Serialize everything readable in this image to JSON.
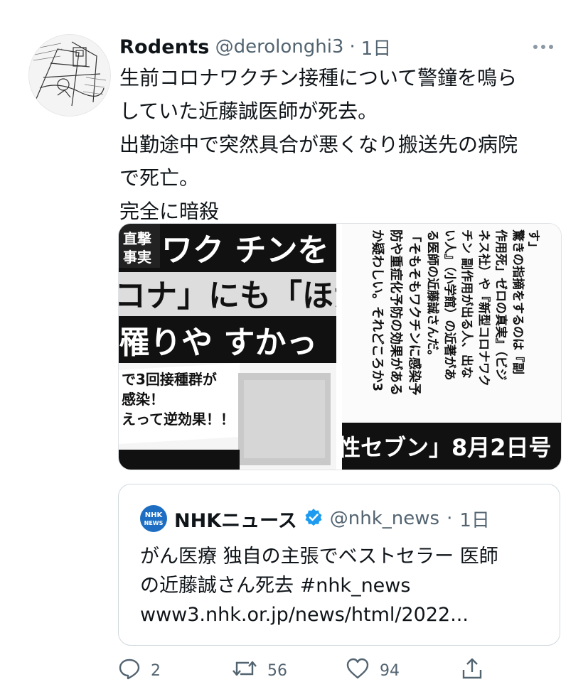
{
  "tweet": {
    "display_name": "Rodents",
    "handle": "@derolonghi3",
    "separator": "·",
    "time": "1日",
    "text_lines": [
      "生前コロナワクチン接種について警鐘を鳴ら",
      "していた近藤誠医師が死去。",
      "出勤途中で突然具合が悪くなり搬送先の病院",
      "で死亡。",
      "完全に暗殺"
    ]
  },
  "media": {
    "left": {
      "lines": [
        "ワク チンを",
        "コナ」にも「ほか",
        "罹りや すかっ",
        "で3回接種群が",
        "感染！",
        "えって逆効果！！"
      ],
      "corner": [
        "直撃",
        "事実"
      ]
    },
    "right": {
      "columns": [
        "す」",
        "驚きの指摘をするのは『副",
        "作用死」ゼロの真実』（ビジ",
        "ネス社）や『新型コロナワク",
        "チン 副作用が出る人、出な",
        "い人』（小学館）の近著があ",
        "る医師の近藤誠さんだ。",
        "「そもそもワクチンに感染予",
        "防や重症化予防の効果がある",
        "か疑わしい。それどころか3"
      ],
      "banner": "性セブン」8月2日号"
    }
  },
  "quote": {
    "logo_text_top": "NHK",
    "logo_text_bottom": "NEWS",
    "display_name": "NHKニュース",
    "handle": "@nhk_news",
    "separator": "·",
    "time": "1日",
    "text_lines": [
      "がん医療 独自の主張でベストセラー 医師",
      "の近藤誠さん死去 #nhk_news",
      "www3.nhk.or.jp/news/html/2022..."
    ]
  },
  "actions": {
    "reply_count": "2",
    "retweet_count": "56",
    "like_count": "94"
  },
  "icons": [
    "more-icon",
    "verified-badge-icon",
    "reply-icon",
    "retweet-icon",
    "like-icon",
    "share-icon"
  ],
  "colors": {
    "text": "#0f1419",
    "muted": "#536471",
    "verified": "#1d9bf0",
    "nhk_blue": "#1d6ec2",
    "border": "#cfd9de"
  }
}
